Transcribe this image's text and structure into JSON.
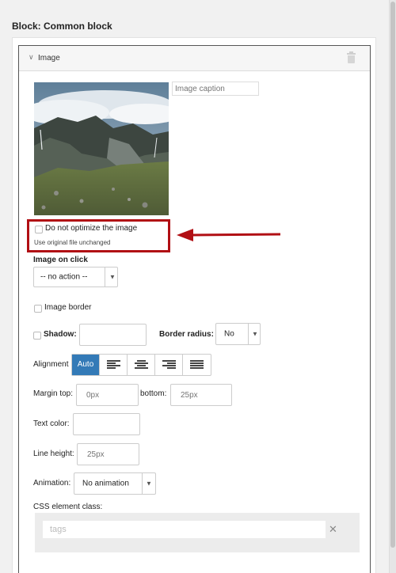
{
  "block": {
    "title": "Block: Common block"
  },
  "panel": {
    "title": "Image",
    "chevron": "chevron-down-icon",
    "delete_icon": "trash-icon"
  },
  "image": {
    "caption_placeholder": "Image caption",
    "optimize_label": "Do not optimize the image",
    "optimize_hint": "Use original file unchanged",
    "optimize_checked": false
  },
  "annotation": {
    "arrow_color": "#b10f14"
  },
  "on_click": {
    "label": "Image on click",
    "selected": "-- no action --"
  },
  "border": {
    "label": "Image border",
    "checked": false
  },
  "shadow": {
    "label": "Shadow:",
    "value": ""
  },
  "border_radius": {
    "label": "Border radius:",
    "selected": "No"
  },
  "alignment": {
    "label": "Alignment",
    "options": [
      "Auto",
      "align-left-icon",
      "align-center-icon",
      "align-right-icon",
      "align-justify-icon"
    ],
    "selected": "Auto",
    "accent": "#337ab7"
  },
  "margin": {
    "top_label": "Margin top:",
    "top_placeholder": "0px",
    "bottom_label": "bottom:",
    "bottom_placeholder": "25px"
  },
  "text_color": {
    "label": "Text color:",
    "value": ""
  },
  "line_height": {
    "label": "Line height:",
    "placeholder": "25px"
  },
  "animation": {
    "label": "Animation:",
    "selected": "No animation"
  },
  "css_class": {
    "label": "CSS element class:",
    "placeholder": "tags",
    "clear_icon": "close-icon"
  }
}
